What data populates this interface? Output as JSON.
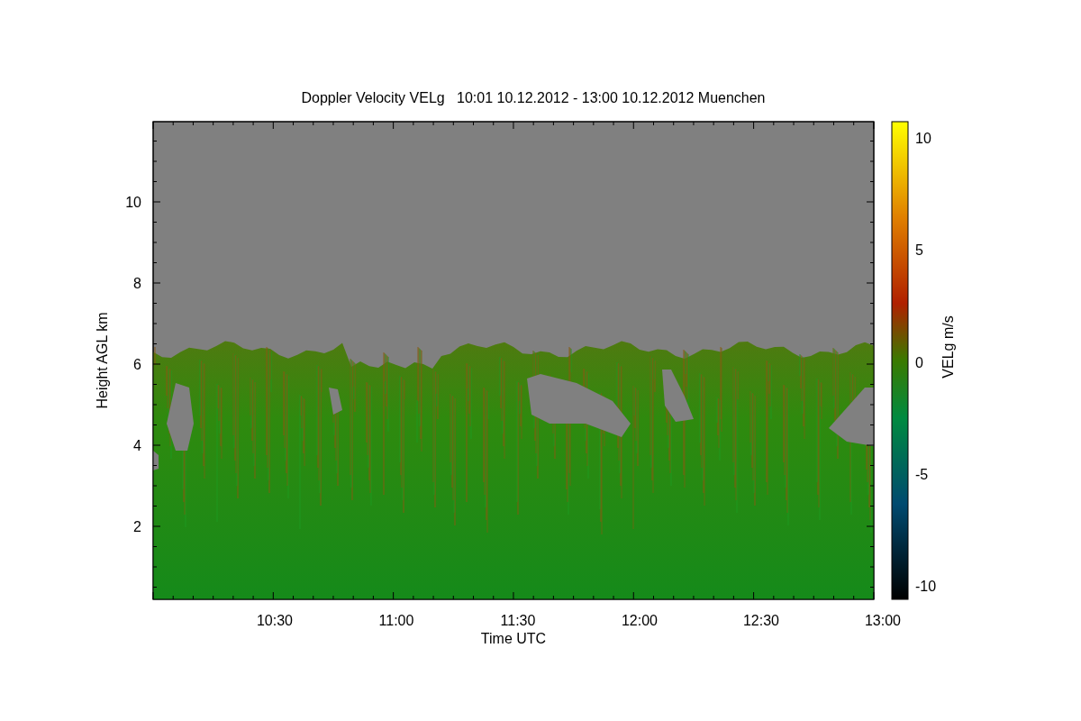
{
  "title": "Doppler Velocity VELg   10:01 10.12.2012 - 13:00 10.12.2012 Muenchen",
  "x_axis": {
    "label": "Time UTC",
    "ticks": [
      "10:30",
      "11:00",
      "11:30",
      "12:00",
      "12:30",
      "13:00"
    ]
  },
  "y_axis": {
    "label": "Height AGL km",
    "ticks": [
      "10",
      "8",
      "6",
      "4",
      "2"
    ]
  },
  "colorbar": {
    "label": "VELg m/s",
    "ticks": [
      "10",
      "5",
      "0",
      "-5",
      "-10"
    ]
  }
}
